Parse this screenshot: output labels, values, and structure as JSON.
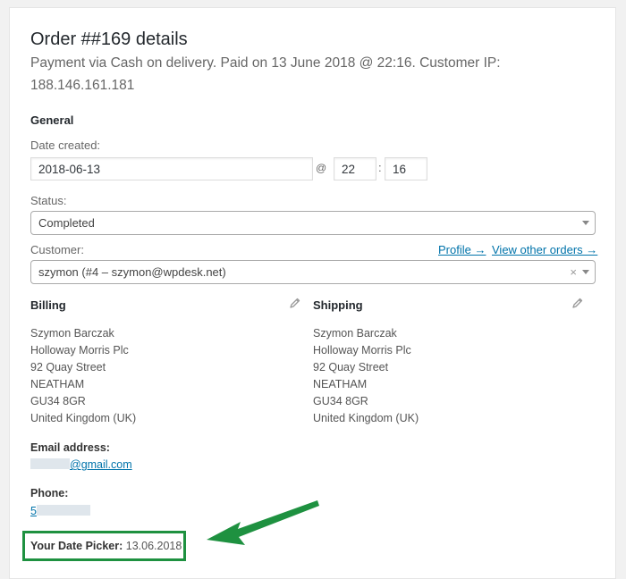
{
  "order": {
    "title": "Order ##169 details",
    "subtitle": "Payment via Cash on delivery. Paid on 13 June 2018 @ 22:16. Customer IP: 188.146.161.181"
  },
  "general": {
    "heading": "General",
    "date_label": "Date created:",
    "date_value": "2018-06-13",
    "at_sign": "@",
    "hour_value": "22",
    "colon": ":",
    "minute_value": "16",
    "status_label": "Status:",
    "status_value": "Completed",
    "customer_label": "Customer:",
    "profile_link": "Profile →",
    "view_orders_link": "View other orders →",
    "customer_value": "szymon (#4 – szymon@wpdesk.net)",
    "clear_icon": "×"
  },
  "billing": {
    "heading": "Billing",
    "lines": [
      "Szymon Barczak",
      "Holloway Morris Plc",
      "92 Quay Street",
      "NEATHAM",
      "GU34 8GR",
      "United Kingdom (UK)"
    ],
    "email_label": "Email address:",
    "email_visible": "@gmail.com",
    "phone_label": "Phone:",
    "phone_visible": "5"
  },
  "shipping": {
    "heading": "Shipping",
    "lines": [
      "Szymon Barczak",
      "Holloway Morris Plc",
      "92 Quay Street",
      "NEATHAM",
      "GU34 8GR",
      "United Kingdom (UK)"
    ]
  },
  "date_picker": {
    "label": "Your Date Picker:",
    "value": "13.06.2018"
  },
  "colors": {
    "link": "#0073aa",
    "highlight_green": "#1e9140"
  },
  "icons": {
    "edit": "pencil-icon",
    "dropdown": "caret-down-icon",
    "annotation": "green-arrow-icon"
  }
}
